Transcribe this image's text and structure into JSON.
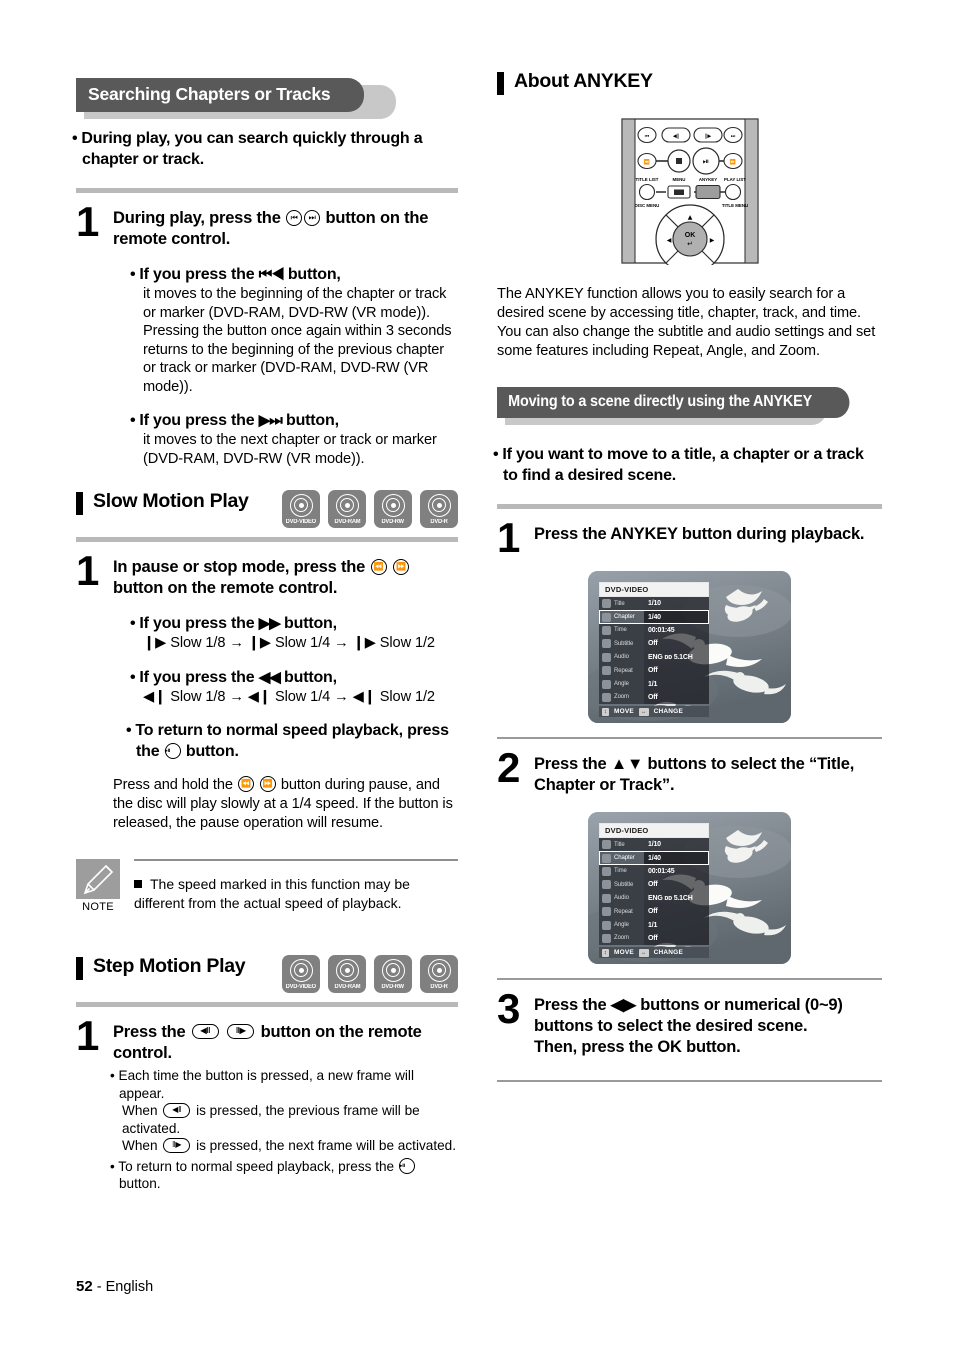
{
  "page": {
    "number": "52",
    "separator": "-",
    "language": "English"
  },
  "left_column": {
    "banner": "Searching Chapters or Tracks",
    "intro_bullet": "During play, you can search quickly through a chapter or track.",
    "step1": {
      "number": "1",
      "title_part1": "During play, press the",
      "title_part2": "button on the remote control.",
      "bullet1_title": "If you press the",
      "bullet1_glyph": "⏮◀",
      "bullet1_title_end": "button,",
      "bullet1_text": "it moves to the beginning of the chapter or track or marker (DVD-RAM, DVD-RW (VR mode)). Pressing the button once again within 3 seconds returns to the beginning of the previous chapter or track or marker (DVD-RAM, DVD-RW (VR mode)).",
      "bullet2_title": "If you press the",
      "bullet2_glyph": "▶⏭",
      "bullet2_title_end": "button,",
      "bullet2_text": "it moves to the next chapter or track or marker (DVD-RAM, DVD-RW (VR mode))."
    },
    "slow_motion": {
      "heading": "Slow Motion Play",
      "badges": [
        "DVD-VIDEO",
        "DVD-RAM",
        "DVD-RW",
        "DVD-R"
      ],
      "step_number": "1",
      "step_title_part1": "In pause or stop mode, press the",
      "step_title_part2": "button on the remote control.",
      "bullet1_title": "If you press the",
      "bullet1_glyph": "▶▶",
      "bullet1_title_end": "button,",
      "bullet1_speeds": "❙▶ Slow 1/8 → ❙▶ Slow 1/4 → ❙▶ Slow 1/2",
      "bullet2_title": "If you press the",
      "bullet2_glyph": "◀◀",
      "bullet2_title_end": "button,",
      "bullet2_speeds": "◀❙ Slow 1/8 → ◀❙ Slow 1/4 → ◀❙ Slow 1/2",
      "bullet3_part1": "To return to normal speed playback, press the",
      "bullet3_part2": "button.",
      "paragraph_part1": "Press and hold the",
      "paragraph_part2": "button during pause, and the disc will play slowly at a 1/4 speed. If the button is released, the pause operation will resume."
    },
    "note": {
      "label": "NOTE",
      "text": "The speed marked in this function may be different from the actual speed of playback."
    },
    "step_motion": {
      "heading": "Step Motion Play",
      "badges": [
        "DVD-VIDEO",
        "DVD-RAM",
        "DVD-RW",
        "DVD-R"
      ],
      "step_number": "1",
      "step_title_part1": "Press the",
      "step_title_part2": "button on the remote control.",
      "bullet1_line1": "Each time the button is pressed, a new frame will appear.",
      "bullet1_line2_a": "When",
      "bullet1_line2_b": "is pressed, the previous frame will be activated.",
      "bullet1_line3_a": "When",
      "bullet1_line3_b": "is pressed, the next frame will be activated.",
      "bullet2_a": "To return to normal speed playback, press the",
      "bullet2_b": "button."
    }
  },
  "right_column": {
    "heading": "About ANYKEY",
    "remote": {
      "labels_top": [
        "TITLE LIST",
        "MENU",
        "ANYKEY",
        "PLAY LIST"
      ],
      "labels_bottom": [
        "DISC MENU",
        "TITLE MENU"
      ],
      "ok_label": "OK"
    },
    "description": "The ANYKEY function allows you to easily search for a desired scene by accessing title, chapter, track, and time. You can also change the subtitle and audio settings and set some features including Repeat, Angle, and Zoom.",
    "banner": "Moving to a scene directly using the ANYKEY",
    "intro_bullet": "If you want to move to a title, a chapter or a track to find a desired scene.",
    "step1": {
      "number": "1",
      "title": "Press the ANYKEY button during playback."
    },
    "step2": {
      "number": "2",
      "title": "Press the ▲▼ buttons to select the “Title, Chapter or Track”."
    },
    "step3": {
      "number": "3",
      "title": "Press the ◀▶ buttons or numerical (0~9) buttons to select the desired scene.",
      "title_line2": "Then, press the OK button."
    },
    "osd": {
      "title": "DVD-VIDEO",
      "rows": [
        {
          "label": "Title",
          "value": "1/10",
          "selected": false
        },
        {
          "label": "Chapter",
          "value": "1/40",
          "selected": true
        },
        {
          "label": "Time",
          "value": "00:01:45",
          "selected": false
        },
        {
          "label": "Subtitle",
          "value": "Off",
          "selected": false
        },
        {
          "label": "Audio",
          "value": "ENG ᴅᴅ 5.1CH",
          "selected": false
        },
        {
          "label": "Repeat",
          "value": "Off",
          "selected": false
        },
        {
          "label": "Angle",
          "value": "1/1",
          "selected": false
        },
        {
          "label": "Zoom",
          "value": "Off",
          "selected": false
        }
      ],
      "footer_move": "MOVE",
      "footer_change": "CHANGE",
      "footer_move_icon": "↕",
      "footer_change_icon": "↔"
    }
  },
  "colors": {
    "banner_bg": "#595959",
    "banner_shadow": "#c8c8c8",
    "badge_bg": "#808080",
    "rule_gray": "#b9b9b9",
    "note_icon_bg": "#9d9d9d"
  }
}
